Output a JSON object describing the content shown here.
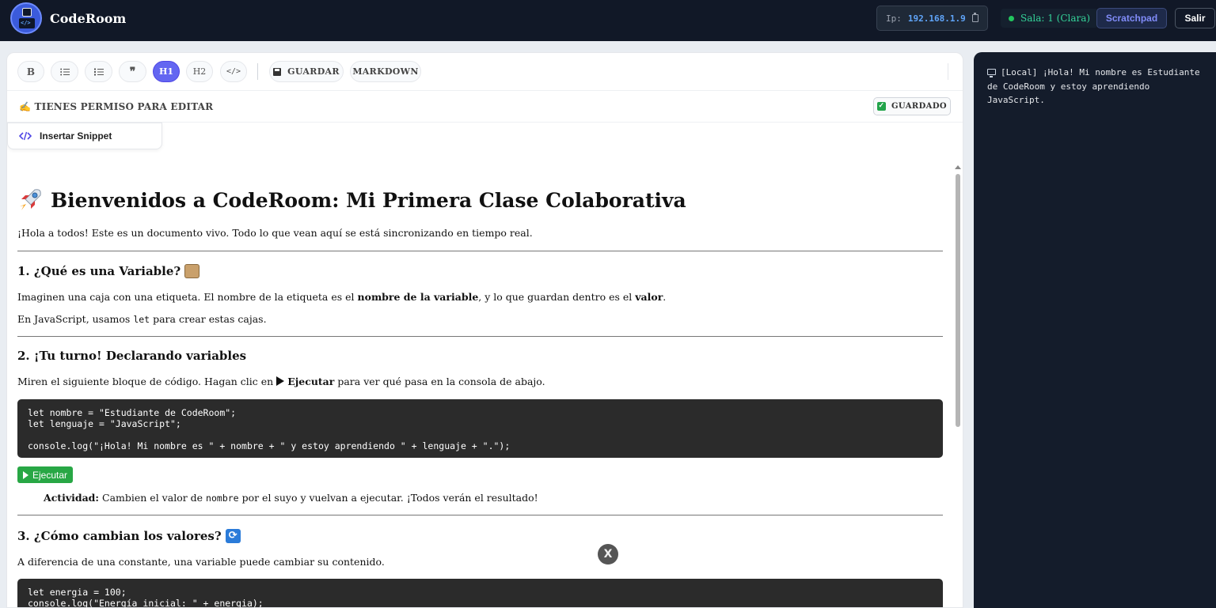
{
  "header": {
    "brand": "CodeRoom",
    "ip_label": "Ip:",
    "ip_value": "192.168.1.9",
    "room": "Sala: 1 (Clara)",
    "scratchpad_label": "Scratchpad",
    "exit_label": "Salir",
    "accent": "#6366f1"
  },
  "toolbar": {
    "bold": "B",
    "h1": "H1",
    "h2": "H2",
    "code": "</>",
    "save_label": "GUARDAR",
    "markdown_label": "MARKDOWN",
    "icons": [
      "bold-icon",
      "bullet-list-icon",
      "numbered-list-icon",
      "quote-icon",
      "code-icon",
      "save-icon"
    ]
  },
  "permissions": {
    "text": "✍️ TIENES PERMISO PARA EDITAR",
    "saved_label": "GUARDADO",
    "saved_check": "✓"
  },
  "snippet": {
    "label": "Insertar Snippet"
  },
  "document": {
    "title": "Bienvenidos a CodeRoom: Mi Primera Clase Colaborativa",
    "intro": "¡Hola a todos! Este es un documento vivo. Todo lo que vean aquí se está sincronizando en tiempo real.",
    "s1_title": "1. ¿Qué es una Variable?",
    "s1_p1_a": "Imaginen una caja con una etiqueta. El nombre de la etiqueta es el ",
    "s1_p1_b": "nombre de la variable",
    "s1_p1_c": ", y lo que guardan dentro es el ",
    "s1_p1_d": "valor",
    "s1_p1_e": ".",
    "s1_p2_a": "En JavaScript, usamos ",
    "s1_p2_code": "let",
    "s1_p2_b": " para crear estas cajas.",
    "s2_title": "2. ¡Tu turno! Declarando variables",
    "s2_p1_a": "Miren el siguiente bloque de código. Hagan clic en ",
    "s2_p1_b": "Ejecutar",
    "s2_p1_c": " para ver qué pasa en la consola de abajo.",
    "code1": "let nombre = \"Estudiante de CodeRoom\";\nlet lenguaje = \"JavaScript\";\n\nconsole.log(\"¡Hola! Mi nombre es \" + nombre + \" y estoy aprendiendo \" + lenguaje + \".\");",
    "run_label": "Ejecutar",
    "activity_label": "Actividad:",
    "activity_a": " Cambien el valor de ",
    "activity_code": "nombre",
    "activity_b": " por el suyo y vuelvan a ejecutar. ¡Todos verán el resultado!",
    "s3_title": "3. ¿Cómo cambian los valores?",
    "s3_p1": "A diferencia de una constante, una variable puede cambiar su contenido.",
    "code2": "let energia = 100;\nconsole.log(\"Energía inicial: \" + energia);",
    "close_label": "X"
  },
  "console": {
    "output": "[Local] ¡Hola! Mi nombre es Estudiante de CodeRoom y estoy aprendiendo JavaScript."
  }
}
